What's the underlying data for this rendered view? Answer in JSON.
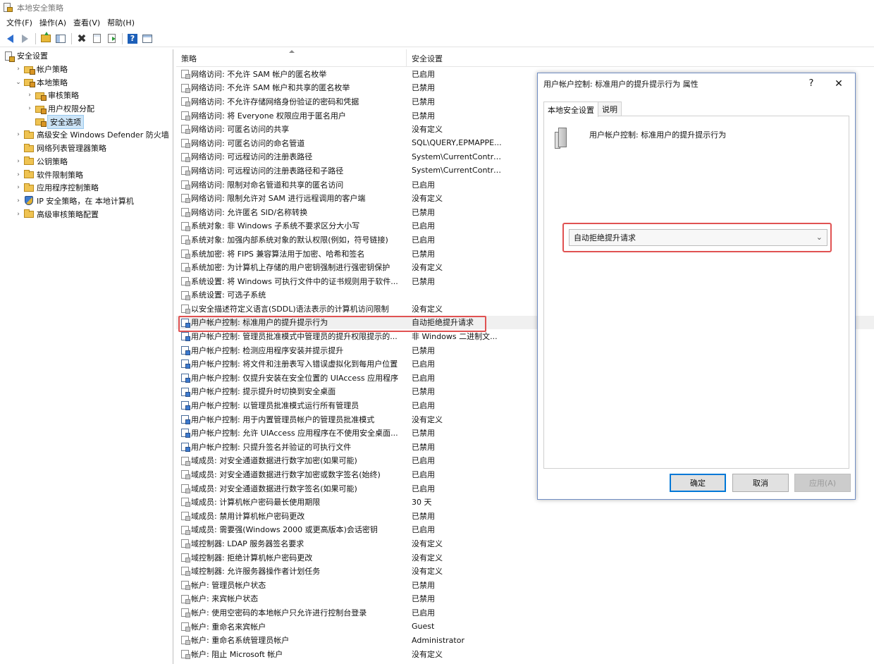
{
  "window": {
    "title": "本地安全策略"
  },
  "menu": [
    "文件(F)",
    "操作(A)",
    "查看(V)",
    "帮助(H)"
  ],
  "toolbar": {
    "icons": [
      "back-arrow-icon",
      "forward-arrow-icon",
      "folder-up-icon",
      "show-pane-icon",
      "delete-icon",
      "properties-icon",
      "export-icon",
      "help-icon",
      "console-icon"
    ],
    "accent": "#2f6fcf"
  },
  "tree": {
    "items": [
      {
        "label": "安全设置",
        "level": 0,
        "expander": "",
        "icon": "policy-doc-icon"
      },
      {
        "label": "帐户策略",
        "level": 1,
        "expander": ">",
        "icon": "lock-folder-icon"
      },
      {
        "label": "本地策略",
        "level": 1,
        "expander": "v",
        "icon": "lock-folder-icon"
      },
      {
        "label": "审核策略",
        "level": 2,
        "expander": ">",
        "icon": "lock-folder-icon"
      },
      {
        "label": "用户权限分配",
        "level": 2,
        "expander": ">",
        "icon": "lock-folder-icon"
      },
      {
        "label": "安全选项",
        "level": 2,
        "expander": "",
        "icon": "lock-folder-icon",
        "selected": true
      },
      {
        "label": "高级安全 Windows Defender 防火墙",
        "level": 1,
        "expander": ">",
        "icon": "folder-icon"
      },
      {
        "label": "网络列表管理器策略",
        "level": 1,
        "expander": "",
        "icon": "folder-icon"
      },
      {
        "label": "公钥策略",
        "level": 1,
        "expander": ">",
        "icon": "folder-icon"
      },
      {
        "label": "软件限制策略",
        "level": 1,
        "expander": ">",
        "icon": "folder-icon"
      },
      {
        "label": "应用程序控制策略",
        "level": 1,
        "expander": ">",
        "icon": "folder-icon"
      },
      {
        "label": "IP 安全策略，在 本地计算机",
        "level": 1,
        "expander": ">",
        "icon": "shield-icon"
      },
      {
        "label": "高级审核策略配置",
        "level": 1,
        "expander": ">",
        "icon": "folder-icon"
      }
    ]
  },
  "list": {
    "columns": [
      "策略",
      "安全设置"
    ],
    "rows": [
      {
        "policy": "网络访问: 不允许 SAM 帐户的匿名枚举",
        "value": "已启用"
      },
      {
        "policy": "网络访问: 不允许 SAM 帐户和共享的匿名枚举",
        "value": "已禁用"
      },
      {
        "policy": "网络访问: 不允许存储网络身份验证的密码和凭据",
        "value": "已禁用"
      },
      {
        "policy": "网络访问: 将 Everyone 权限应用于匿名用户",
        "value": "已禁用"
      },
      {
        "policy": "网络访问: 可匿名访问的共享",
        "value": "没有定义"
      },
      {
        "policy": "网络访问: 可匿名访问的命名管道",
        "value": "SQL\\QUERY,EPMAPPE..."
      },
      {
        "policy": "网络访问: 可远程访问的注册表路径",
        "value": "System\\CurrentContro..."
      },
      {
        "policy": "网络访问: 可远程访问的注册表路径和子路径",
        "value": "System\\CurrentContro..."
      },
      {
        "policy": "网络访问: 限制对命名管道和共享的匿名访问",
        "value": "已启用"
      },
      {
        "policy": "网络访问: 限制允许对 SAM 进行远程调用的客户端",
        "value": "没有定义"
      },
      {
        "policy": "网络访问: 允许匿名 SID/名称转换",
        "value": "已禁用"
      },
      {
        "policy": "系统对象: 非 Windows 子系统不要求区分大小写",
        "value": "已启用"
      },
      {
        "policy": "系统对象: 加强内部系统对象的默认权限(例如，符号链接)",
        "value": "已启用"
      },
      {
        "policy": "系统加密: 将 FIPS 兼容算法用于加密、哈希和签名",
        "value": "已禁用"
      },
      {
        "policy": "系统加密: 为计算机上存储的用户密钥强制进行强密钥保护",
        "value": "没有定义"
      },
      {
        "policy": "系统设置: 将 Windows 可执行文件中的证书规则用于软件...",
        "value": "已禁用"
      },
      {
        "policy": "系统设置: 可选子系统",
        "value": ""
      },
      {
        "policy": "以安全描述符定义语言(SDDL)语法表示的计算机访问限制",
        "value": "没有定义"
      },
      {
        "policy": "用户帐户控制: 标准用户的提升提示行为",
        "value": "自动拒绝提升请求",
        "highlight": true,
        "uac": true
      },
      {
        "policy": "用户帐户控制: 管理员批准模式中管理员的提升权限提示的...",
        "value": "非 Windows 二进制文...",
        "uac": true
      },
      {
        "policy": "用户帐户控制: 检测应用程序安装并提示提升",
        "value": "已禁用",
        "uac": true
      },
      {
        "policy": "用户帐户控制: 将文件和注册表写入错误虚拟化到每用户位置",
        "value": "已启用",
        "uac": true
      },
      {
        "policy": "用户帐户控制: 仅提升安装在安全位置的 UIAccess 应用程序",
        "value": "已启用",
        "uac": true
      },
      {
        "policy": "用户帐户控制: 提示提升时切换到安全桌面",
        "value": "已禁用",
        "uac": true
      },
      {
        "policy": "用户帐户控制: 以管理员批准模式运行所有管理员",
        "value": "已启用",
        "uac": true
      },
      {
        "policy": "用户帐户控制: 用于内置管理员帐户的管理员批准模式",
        "value": "没有定义",
        "uac": true
      },
      {
        "policy": "用户帐户控制: 允许 UIAccess 应用程序在不使用安全桌面...",
        "value": "已禁用",
        "uac": true
      },
      {
        "policy": "用户帐户控制: 只提升签名并验证的可执行文件",
        "value": "已禁用",
        "uac": true
      },
      {
        "policy": "域成员: 对安全通道数据进行数字加密(如果可能)",
        "value": "已启用"
      },
      {
        "policy": "域成员: 对安全通道数据进行数字加密或数字签名(始终)",
        "value": "已启用"
      },
      {
        "policy": "域成员: 对安全通道数据进行数字签名(如果可能)",
        "value": "已启用"
      },
      {
        "policy": "域成员: 计算机帐户密码最长使用期限",
        "value": "30 天"
      },
      {
        "policy": "域成员: 禁用计算机帐户密码更改",
        "value": "已禁用"
      },
      {
        "policy": "域成员: 需要强(Windows 2000 或更高版本)会话密钥",
        "value": "已启用"
      },
      {
        "policy": "域控制器: LDAP 服务器签名要求",
        "value": "没有定义"
      },
      {
        "policy": "域控制器: 拒绝计算机帐户密码更改",
        "value": "没有定义"
      },
      {
        "policy": "域控制器: 允许服务器操作者计划任务",
        "value": "没有定义"
      },
      {
        "policy": "帐户: 管理员帐户状态",
        "value": "已禁用"
      },
      {
        "policy": "帐户: 来宾帐户状态",
        "value": "已禁用"
      },
      {
        "policy": "帐户: 使用空密码的本地帐户只允许进行控制台登录",
        "value": "已启用"
      },
      {
        "policy": "帐户: 重命名来宾帐户",
        "value": "Guest"
      },
      {
        "policy": "帐户: 重命名系统管理员帐户",
        "value": "Administrator"
      },
      {
        "policy": "帐户: 阻止 Microsoft 帐户",
        "value": "没有定义"
      }
    ]
  },
  "dialog": {
    "title": "用户帐户控制: 标准用户的提升提示行为 属性",
    "help_label": "?",
    "close_label": "✕",
    "tabs": [
      "本地安全设置",
      "说明"
    ],
    "active_tab": 0,
    "policy_name": "用户帐户控制: 标准用户的提升提示行为",
    "select_value": "自动拒绝提升请求",
    "buttons": {
      "ok": "确定",
      "cancel": "取消",
      "apply": "应用(A)"
    },
    "highlight_color": "#e05252"
  }
}
